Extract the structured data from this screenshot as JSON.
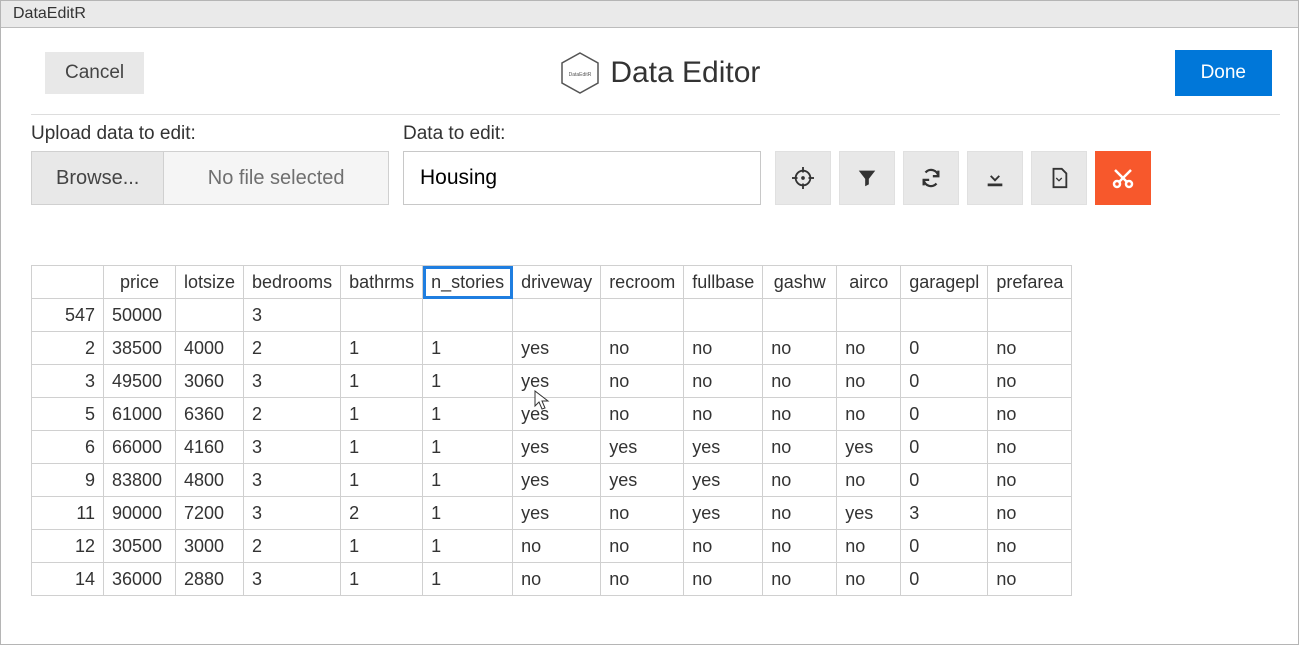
{
  "app": {
    "window_title": "DataEditR"
  },
  "header": {
    "cancel_label": "Cancel",
    "title": "Data Editor",
    "done_label": "Done",
    "logo_text": "DataEditR"
  },
  "controls": {
    "upload_label": "Upload data to edit:",
    "browse_label": "Browse...",
    "no_file_label": "No file selected",
    "select_label": "Data to edit:",
    "select_value": "Housing"
  },
  "icon_buttons": [
    {
      "name": "target-icon"
    },
    {
      "name": "filter-icon"
    },
    {
      "name": "refresh-icon"
    },
    {
      "name": "download-icon"
    },
    {
      "name": "export-icon"
    },
    {
      "name": "cut-icon"
    }
  ],
  "table": {
    "selected_header": "n_stories",
    "columns": [
      "price",
      "lotsize",
      "bedrooms",
      "bathrms",
      "n_stories",
      "driveway",
      "recroom",
      "fullbase",
      "gashw",
      "airco",
      "garagepl",
      "prefarea"
    ],
    "col_classes": [
      "col-price",
      "col-lotsize",
      "col-bedrooms",
      "col-bathrms",
      "col-stories",
      "col-driveway",
      "col-recroom",
      "col-fullbase",
      "col-gashw",
      "col-airco",
      "col-garagepl",
      "col-prefarea"
    ],
    "rows": [
      {
        "n": "547",
        "cells": [
          "50000",
          "",
          "3",
          "",
          "",
          "",
          "",
          "",
          "",
          "",
          "",
          ""
        ]
      },
      {
        "n": "2",
        "cells": [
          "38500",
          "4000",
          "2",
          "1",
          "1",
          "yes",
          "no",
          "no",
          "no",
          "no",
          "0",
          "no"
        ]
      },
      {
        "n": "3",
        "cells": [
          "49500",
          "3060",
          "3",
          "1",
          "1",
          "yes",
          "no",
          "no",
          "no",
          "no",
          "0",
          "no"
        ]
      },
      {
        "n": "5",
        "cells": [
          "61000",
          "6360",
          "2",
          "1",
          "1",
          "yes",
          "no",
          "no",
          "no",
          "no",
          "0",
          "no"
        ]
      },
      {
        "n": "6",
        "cells": [
          "66000",
          "4160",
          "3",
          "1",
          "1",
          "yes",
          "yes",
          "yes",
          "no",
          "yes",
          "0",
          "no"
        ]
      },
      {
        "n": "9",
        "cells": [
          "83800",
          "4800",
          "3",
          "1",
          "1",
          "yes",
          "yes",
          "yes",
          "no",
          "no",
          "0",
          "no"
        ]
      },
      {
        "n": "11",
        "cells": [
          "90000",
          "7200",
          "3",
          "2",
          "1",
          "yes",
          "no",
          "yes",
          "no",
          "yes",
          "3",
          "no"
        ]
      },
      {
        "n": "12",
        "cells": [
          "30500",
          "3000",
          "2",
          "1",
          "1",
          "no",
          "no",
          "no",
          "no",
          "no",
          "0",
          "no"
        ]
      },
      {
        "n": "14",
        "cells": [
          "36000",
          "2880",
          "3",
          "1",
          "1",
          "no",
          "no",
          "no",
          "no",
          "no",
          "0",
          "no"
        ]
      }
    ]
  },
  "colors": {
    "accent": "#0077d9",
    "danger": "#f7582c",
    "border": "#d0d0d0"
  }
}
